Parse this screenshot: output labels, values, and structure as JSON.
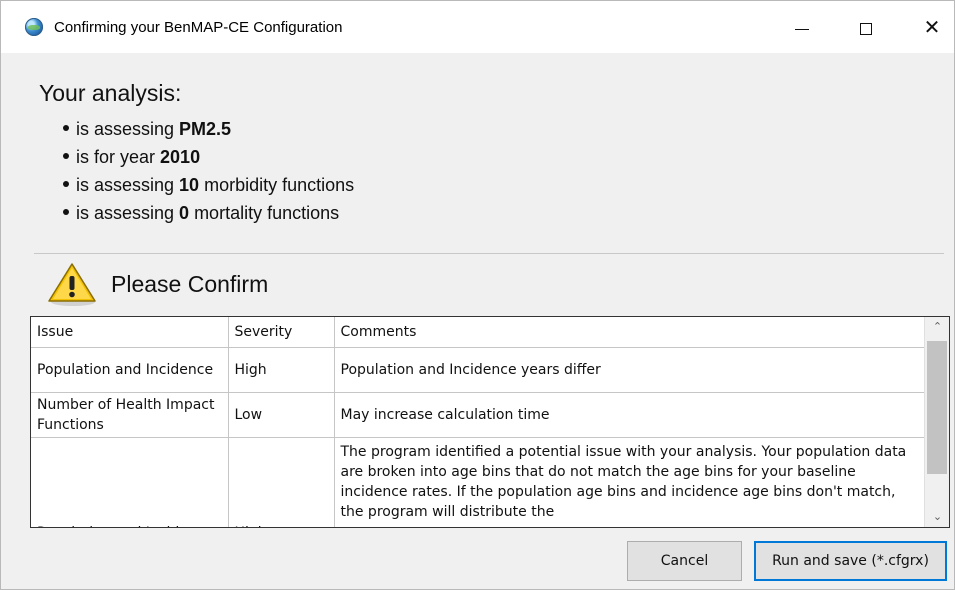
{
  "window": {
    "title": "Confirming your BenMAP-CE Configuration",
    "icon": "globe-icon",
    "controls": {
      "minimize": "minimize-icon",
      "maximize": "maximize-icon",
      "close": "close-icon"
    }
  },
  "analysis": {
    "heading": "Your analysis:",
    "bullets": [
      {
        "prefix": "is assessing ",
        "value": "PM2.5",
        "suffix": ""
      },
      {
        "prefix": "is for year ",
        "value": "2010",
        "suffix": ""
      },
      {
        "prefix": "is assessing ",
        "value": "10",
        "suffix": " morbidity functions"
      },
      {
        "prefix": "is assessing ",
        "value": "0",
        "suffix": " mortality functions"
      }
    ]
  },
  "confirm": {
    "title": "Please Confirm",
    "icon": "warning-icon"
  },
  "table": {
    "columns": [
      "Issue",
      "Severity",
      "Comments"
    ],
    "rows": [
      {
        "issue": "Population and Incidence",
        "severity": "High",
        "comments": "Population and Incidence years differ"
      },
      {
        "issue": "Number of Health Impact Functions",
        "severity": "Low",
        "comments": "May increase calculation time"
      },
      {
        "issue": "Population and Incidence",
        "severity": "High",
        "comments": "The program identified a potential issue with your analysis. Your population data are broken into age bins that do not match the age bins for your baseline incidence rates. If the population age bins and incidence age bins don't match, the program will distribute the"
      }
    ]
  },
  "buttons": {
    "cancel": "Cancel",
    "run": "Run and save  (*.cfgrx)"
  },
  "colors": {
    "accent": "#0078d7",
    "window_bg": "#f0f0f0",
    "warning_yellow": "#f2c200"
  }
}
